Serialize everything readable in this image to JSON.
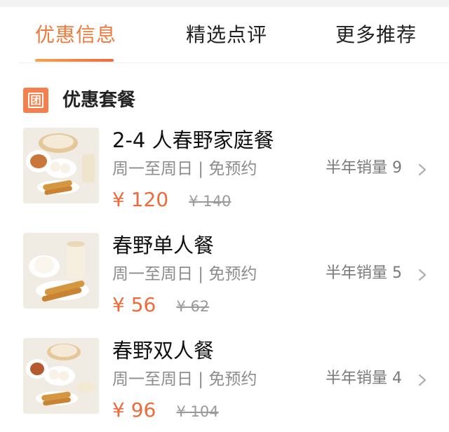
{
  "tabs": [
    {
      "label": "优惠信息",
      "active": true
    },
    {
      "label": "精选点评",
      "active": false
    },
    {
      "label": "更多推荐",
      "active": false
    }
  ],
  "colors": {
    "accent": "#ee6a3a",
    "badge": "#f57f4d",
    "muted": "#8c8c8c"
  },
  "section": {
    "icon_char": "团",
    "icon": "group-buy-icon",
    "title": "优惠套餐"
  },
  "deals": [
    {
      "name": "2-4 人春野家庭餐",
      "subtitle": "周一至周日 | 免预约",
      "price": "¥ 120",
      "original_price": "¥ 140",
      "sales": "半年销量 9"
    },
    {
      "name": "春野单人餐",
      "subtitle": "周一至周日 | 免预约",
      "price": "¥ 56",
      "original_price": "¥ 62",
      "sales": "半年销量 5"
    },
    {
      "name": "春野双人餐",
      "subtitle": "周一至周日 | 免预约",
      "price": "¥ 96",
      "original_price": "¥ 104",
      "sales": "半年销量 4"
    }
  ]
}
